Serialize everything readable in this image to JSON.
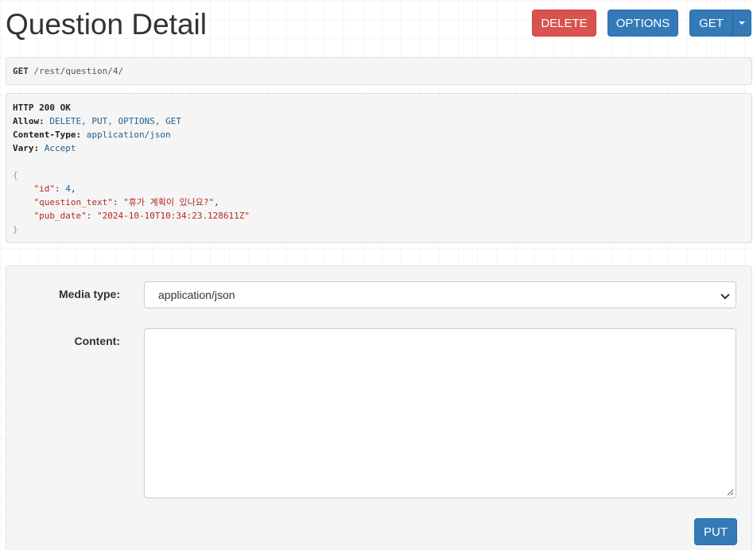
{
  "page": {
    "title": "Question Detail"
  },
  "toolbar": {
    "delete_label": "DELETE",
    "options_label": "OPTIONS",
    "get_label": "GET"
  },
  "request": {
    "method": "GET",
    "path": "/rest/question/4/"
  },
  "response": {
    "status": "HTTP 200 OK",
    "headers": {
      "allow_key": "Allow:",
      "allow_value": "DELETE, PUT, OPTIONS, GET",
      "content_type_key": "Content-Type:",
      "content_type_value": "application/json",
      "vary_key": "Vary:",
      "vary_value": "Accept"
    },
    "body": {
      "open_brace": "{",
      "close_brace": "}",
      "id_key": "\"id\"",
      "id_value": "4",
      "question_text_key": "\"question_text\"",
      "question_text_value": "\"휴가 계획이 있나요?\"",
      "pub_date_key": "\"pub_date\"",
      "pub_date_value": "\"2024-10-10T10:34:23.128611Z\""
    }
  },
  "form": {
    "media_type_label": "Media type:",
    "media_type_value": "application/json",
    "content_label": "Content:",
    "content_value": "",
    "put_label": "PUT"
  },
  "colors": {
    "danger": "#d9534f",
    "primary": "#337ab7",
    "json_string": "#b5281f",
    "json_number": "#1f5f8f"
  }
}
